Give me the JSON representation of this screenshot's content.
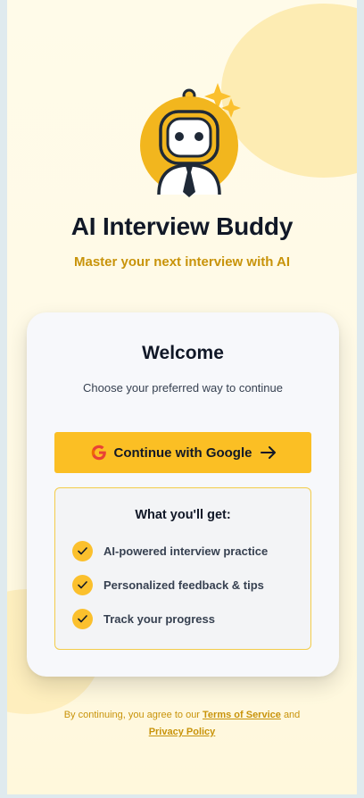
{
  "app": {
    "title": "AI Interview Buddy",
    "subtitle": "Master your next interview with AI",
    "logo_icon": "robot-mascot-icon"
  },
  "card": {
    "title": "Welcome",
    "subtitle": "Choose your preferred way to continue",
    "google_button": {
      "label": "Continue with Google",
      "icon": "google-g-icon",
      "trailing_icon": "arrow-right-icon"
    },
    "benefits": {
      "title": "What you'll get:",
      "items": [
        {
          "label": "AI-powered interview practice",
          "icon": "check-icon"
        },
        {
          "label": "Personalized feedback & tips",
          "icon": "check-icon"
        },
        {
          "label": "Track your progress",
          "icon": "check-icon"
        }
      ]
    }
  },
  "legal": {
    "prefix": "By continuing, you agree to our",
    "terms_link": "Terms of Service",
    "conjunction": "and",
    "privacy_link": "Privacy Policy"
  },
  "colors": {
    "accent": "#fbbf24",
    "accent_text": "#c8930a",
    "text_dark": "#111827",
    "card_bg": "#f7f8fb"
  }
}
